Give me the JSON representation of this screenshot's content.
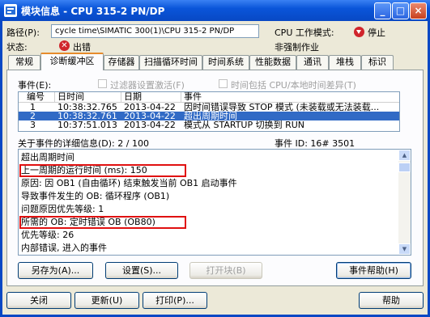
{
  "window": {
    "title": "模块信息 - CPU 315-2 PN/DP",
    "minimize": "_",
    "maximize": "□",
    "close": "×"
  },
  "info": {
    "path_label": "路径(P):",
    "path_value": "cycle time\\SIMATIC 300(1)\\CPU 315-2 PN/DP",
    "state_label": "状态:",
    "state_value": "出错",
    "mode_label": "CPU 工作模式:",
    "mode_value": "停止",
    "forcing": "非强制作业"
  },
  "tabs": [
    "常规",
    "诊断缓冲区",
    "存储器",
    "扫描循环时间",
    "时间系统",
    "性能数据",
    "通讯",
    "堆栈",
    "标识"
  ],
  "events": {
    "label": "事件(E):",
    "filter_label": "过滤器设置激活(F)",
    "time_label": "时间包括 CPU/本地时间差异(T)",
    "columns": [
      "编号",
      "日时间",
      "日期",
      "事件"
    ],
    "rows": [
      {
        "no": "1",
        "time": "10:38:32.765",
        "date": "2013-04-22",
        "event": "因时间错误导致 STOP 模式 (未装载或无法装载..."
      },
      {
        "no": "2",
        "time": "10:38:32.761",
        "date": "2013-04-22",
        "event": "超出周期时间"
      },
      {
        "no": "3",
        "time": "10:37:51.013",
        "date": "2013-04-22",
        "event": "模式从 STARTUP 切换到 RUN"
      }
    ]
  },
  "detail": {
    "header": "关于事件的详细信息(D): 2 / 100",
    "event_id": "事件 ID: 16# 3501",
    "lines": [
      "超出周期时间",
      "上一周期的运行时间 (ms):        150",
      "原因: 因 OB1 (自由循环) 结束触发当前 OB1 启动事件",
      "导致事件发生的 OB: 循环程序 (OB1)",
      "问题原因优先等级: 1",
      "所需的 OB: 定时错误 OB (OB80)",
      "优先等级: 26",
      "内部错误, 进入的事件"
    ]
  },
  "buttons": {
    "save_as": "另存为(A)...",
    "settings": "设置(S)...",
    "open_block": "打开块(B)",
    "event_help": "事件帮助(H)",
    "close": "关闭",
    "refresh": "更新(U)",
    "print": "打印(P)...",
    "help": "帮助"
  },
  "colors": {
    "title_bar": "#0a55d9",
    "selection": "#316ac5",
    "highlight_box": "#e01010",
    "error_icon": "#d0252c"
  },
  "icons": {
    "app": "module-info-icon",
    "state": "error-x-icon",
    "mode": "stop-icon"
  }
}
